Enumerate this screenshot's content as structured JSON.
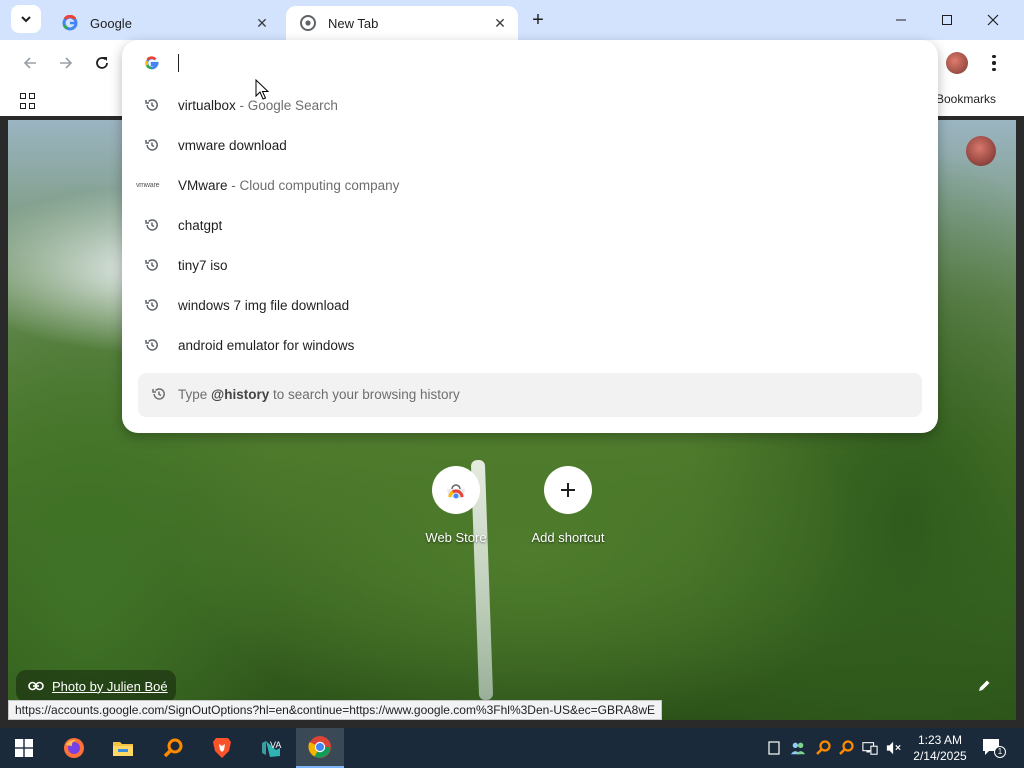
{
  "browser": {
    "tabs": [
      {
        "title": "Google",
        "active": false
      },
      {
        "title": "New Tab",
        "active": true
      }
    ],
    "bookmarks_bar_label": "l Bookmarks",
    "status_url": "https://accounts.google.com/SignOutOptions?hl=en&continue=https://www.google.com%3Fhl%3Den-US&ec=GBRA8wE"
  },
  "omnibox": {
    "value": "",
    "suggestions": [
      {
        "text": "virtualbox",
        "description": " - Google Search",
        "icon": "history-icon"
      },
      {
        "text": "vmware download",
        "description": "",
        "icon": "history-icon"
      },
      {
        "text": "VMware",
        "description": " - Cloud computing company",
        "icon": "vmware-logo"
      },
      {
        "text": "chatgpt",
        "description": "",
        "icon": "history-icon"
      },
      {
        "text": "tiny7 iso",
        "description": "",
        "icon": "history-icon"
      },
      {
        "text": "windows 7 img file download",
        "description": "",
        "icon": "history-icon"
      },
      {
        "text": "android emulator for windows",
        "description": "",
        "icon": "history-icon"
      }
    ],
    "history_hint": {
      "prefix": "Type ",
      "keyword": "@history",
      "suffix": " to search your browsing history"
    },
    "vmware_logo_text": "vmware"
  },
  "new_tab_page": {
    "shortcuts": [
      {
        "label": "Web Store"
      },
      {
        "label": "Add shortcut"
      }
    ],
    "photo_credit": "Photo by Julien Boé"
  },
  "taskbar": {
    "apps": [
      "start",
      "firefox",
      "file-explorer",
      "search-tool",
      "brave",
      "visual-studio",
      "chrome"
    ],
    "clock_time": "1:23 AM",
    "clock_date": "2/14/2025",
    "notification_count": "1"
  },
  "colors": {
    "tabstrip": "#d3e3fd",
    "taskbar": "#1b2a3a",
    "accent": "#1a73e8"
  }
}
